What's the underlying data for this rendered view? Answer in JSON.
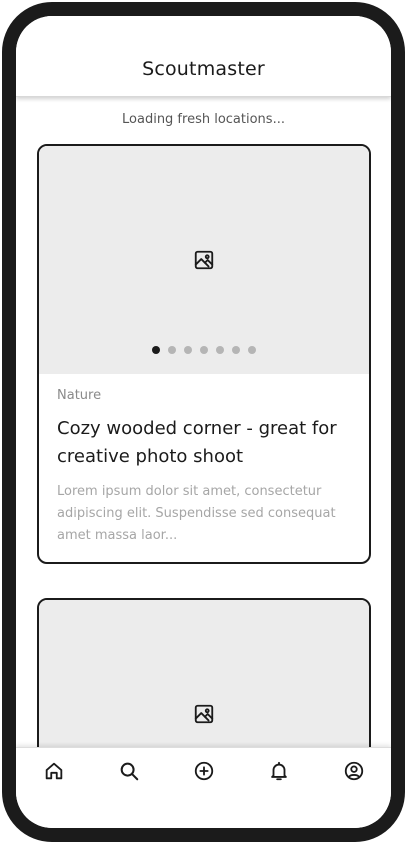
{
  "app": {
    "title": "Scoutmaster"
  },
  "status": {
    "loading_text": "Loading fresh locations..."
  },
  "cards": [
    {
      "category": "Nature",
      "title": "Cozy wooded corner - great for creative photo shoot",
      "description": "Lorem ipsum dolor sit amet, consectetur adipiscing elit. Suspendisse sed consequat amet massa laor...",
      "image_icon": "image-icon",
      "carousel": {
        "total": 7,
        "active_index": 0
      }
    },
    {
      "image_icon": "image-icon"
    }
  ],
  "tabbar": {
    "items": [
      {
        "icon": "home-icon"
      },
      {
        "icon": "search-icon"
      },
      {
        "icon": "plus-circle-icon"
      },
      {
        "icon": "bell-icon"
      },
      {
        "icon": "user-circle-icon"
      }
    ]
  },
  "colors": {
    "frame": "#1b1b1b",
    "image_placeholder": "#ececec",
    "dot_active": "#1b1b1b",
    "dot_inactive": "#b5b5b5",
    "muted_text": "#a6a6a6"
  }
}
